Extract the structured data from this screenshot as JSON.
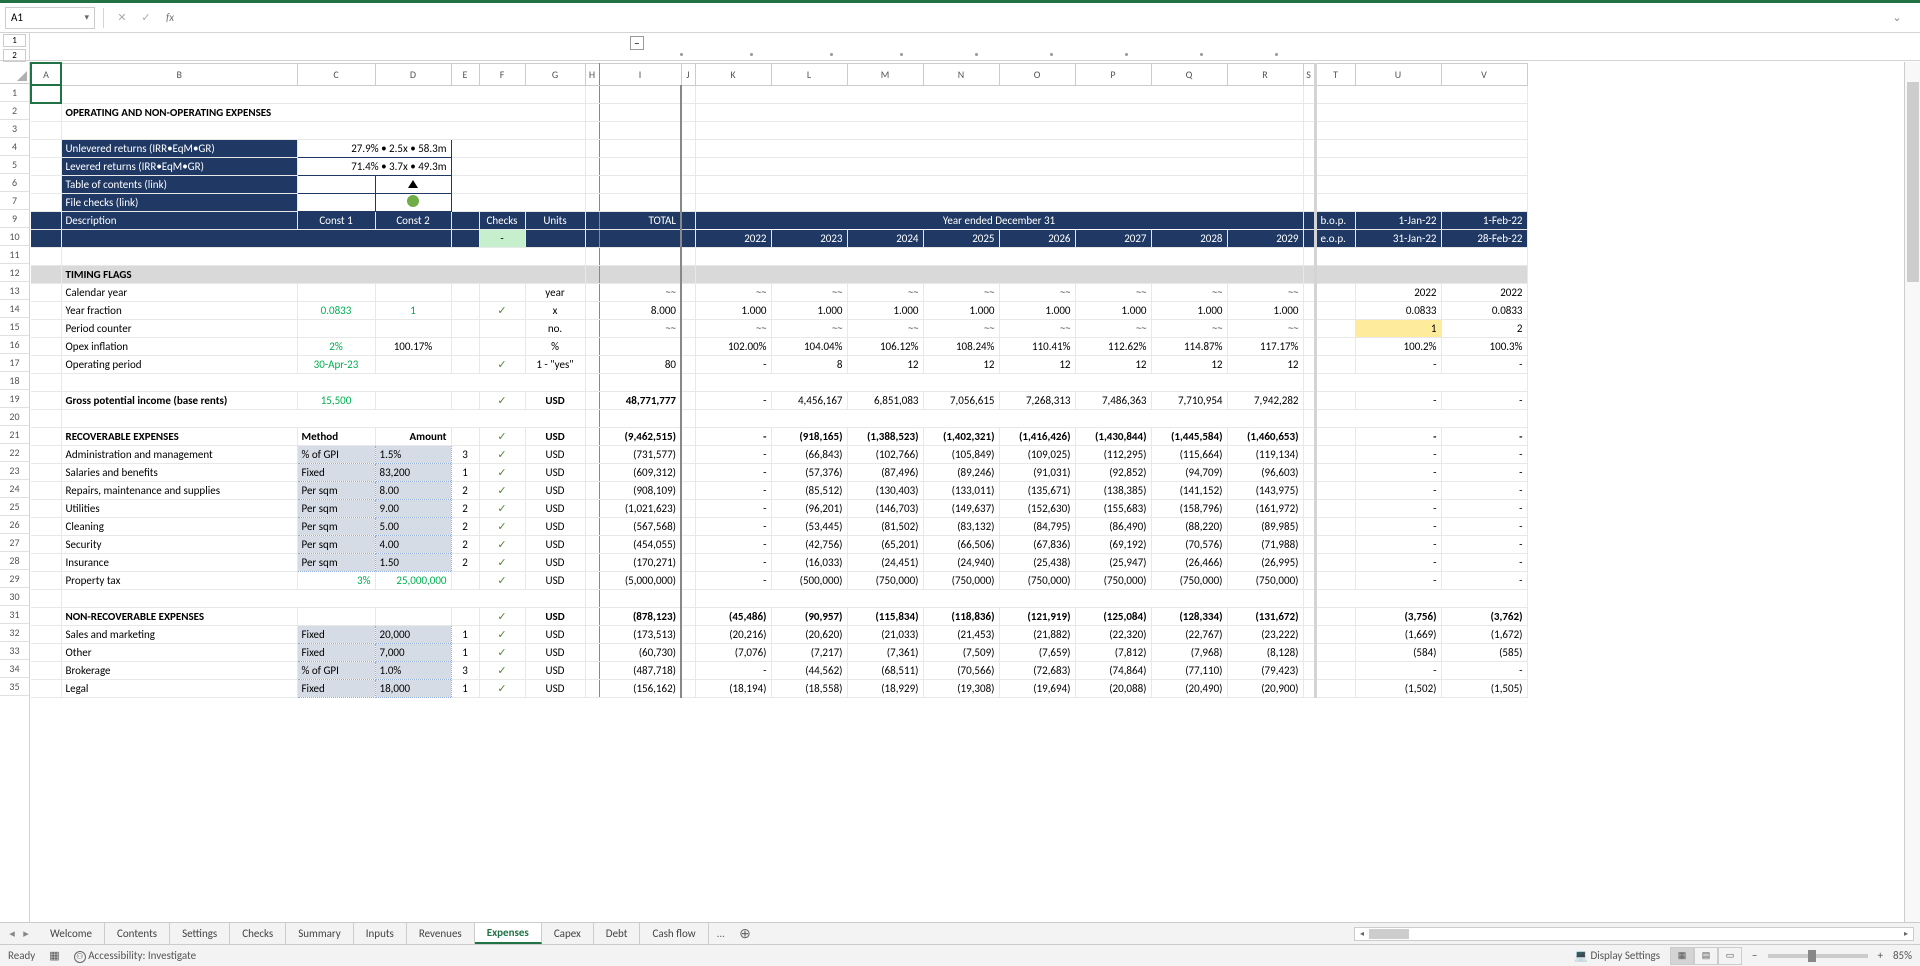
{
  "cell_ref": "A1",
  "fx_label": "fx",
  "outline": {
    "level1": "1",
    "level2": "2",
    "minus": "−"
  },
  "title": "OPERATING AND NON-OPERATING EXPENSES",
  "summary": {
    "unlev_label": "Unlevered returns (IRR•EqM•GR)",
    "unlev_val": "27.9% • 2.5x • 58.3m",
    "lev_label": "Levered returns (IRR•EqM•GR)",
    "lev_val": "71.4% • 3.7x • 49.3m",
    "toc": "Table of contents (link)",
    "checks": "File checks (link)"
  },
  "hdr": {
    "desc": "Description",
    "c1": "Const 1",
    "c2": "Const 2",
    "checks": "Checks",
    "units": "Units",
    "total": "TOTAL",
    "year_ended": "Year ended December 31",
    "bop": "b.o.p.",
    "eop": "e.o.p.",
    "d1": "1-Jan-22",
    "d2": "1-Feb-22",
    "d3": "31-Jan-22",
    "d4": "28-Feb-22",
    "dash": "-"
  },
  "years": [
    "2022",
    "2023",
    "2024",
    "2025",
    "2026",
    "2027",
    "2028",
    "2029"
  ],
  "cols": [
    "A",
    "B",
    "C",
    "D",
    "E",
    "F",
    "G",
    "H",
    "I",
    "J",
    "K",
    "L",
    "M",
    "N",
    "O",
    "P",
    "Q",
    "R",
    "S",
    "T",
    "U",
    "V"
  ],
  "rows": [
    "1",
    "2",
    "3",
    "4",
    "5",
    "6",
    "7",
    "9",
    "10",
    "11",
    "12",
    "13",
    "14",
    "15",
    "16",
    "17",
    "18",
    "19",
    "20",
    "21",
    "22",
    "23",
    "24",
    "25",
    "26",
    "27",
    "28",
    "29",
    "30",
    "31",
    "32",
    "33",
    "34",
    "35"
  ],
  "sec": {
    "timing": "TIMING FLAGS",
    "recov": "RECOVERABLE EXPENSES",
    "method": "Method",
    "amount": "Amount",
    "nonrecov": "NON-RECOVERABLE EXPENSES"
  },
  "r": {
    "cal": {
      "lbl": "Calendar year",
      "unit": "year",
      "u": "2022",
      "v": "2022"
    },
    "yf": {
      "lbl": "Year fraction",
      "c1": "0.0833",
      "c2": "1",
      "unit": "x",
      "tot": "8.000",
      "vals": [
        "1.000",
        "1.000",
        "1.000",
        "1.000",
        "1.000",
        "1.000",
        "1.000",
        "1.000"
      ],
      "u": "0.0833",
      "v": "0.0833"
    },
    "pc": {
      "lbl": "Period counter",
      "unit": "no.",
      "u": "1",
      "v": "2"
    },
    "oi": {
      "lbl": "Opex inflation",
      "c1": "2%",
      "c2": "100.17%",
      "unit": "%",
      "vals": [
        "102.00%",
        "104.04%",
        "106.12%",
        "108.24%",
        "110.41%",
        "112.62%",
        "114.87%",
        "117.17%"
      ],
      "u": "100.2%",
      "v": "100.3%"
    },
    "op": {
      "lbl": "Operating period",
      "c1": "30-Apr-23",
      "unit": "1 - \"yes\"",
      "tot": "80",
      "vals": [
        "-",
        "8",
        "12",
        "12",
        "12",
        "12",
        "12",
        "12"
      ],
      "u": "-",
      "v": "-"
    },
    "gpi": {
      "lbl": "Gross potential income (base rents)",
      "c1": "15,500",
      "unit": "USD",
      "tot": "48,771,777",
      "vals": [
        "-",
        "4,456,167",
        "6,851,083",
        "7,056,615",
        "7,268,313",
        "7,486,363",
        "7,710,954",
        "7,942,282"
      ],
      "u": "-",
      "v": "-"
    },
    "re": {
      "unit": "USD",
      "tot": "(9,462,515)",
      "vals": [
        "-",
        "(918,165)",
        "(1,388,523)",
        "(1,402,321)",
        "(1,416,426)",
        "(1,430,844)",
        "(1,445,584)",
        "(1,460,653)"
      ],
      "u": "-",
      "v": "-"
    },
    "admin": {
      "lbl": "Administration and management",
      "m": "% of GPI",
      "a": "1.5%",
      "n": "3",
      "unit": "USD",
      "tot": "(731,577)",
      "vals": [
        "-",
        "(66,843)",
        "(102,766)",
        "(105,849)",
        "(109,025)",
        "(112,295)",
        "(115,664)",
        "(119,134)"
      ],
      "u": "-",
      "v": "-"
    },
    "sal": {
      "lbl": "Salaries and benefits",
      "m": "Fixed",
      "a": "83,200",
      "n": "1",
      "unit": "USD",
      "tot": "(609,312)",
      "vals": [
        "-",
        "(57,376)",
        "(87,496)",
        "(89,246)",
        "(91,031)",
        "(92,852)",
        "(94,709)",
        "(96,603)"
      ],
      "u": "-",
      "v": "-"
    },
    "rep": {
      "lbl": "Repairs, maintenance and supplies",
      "m": "Per sqm",
      "a": "8.00",
      "n": "2",
      "unit": "USD",
      "tot": "(908,109)",
      "vals": [
        "-",
        "(85,512)",
        "(130,403)",
        "(133,011)",
        "(135,671)",
        "(138,385)",
        "(141,152)",
        "(143,975)"
      ],
      "u": "-",
      "v": "-"
    },
    "util": {
      "lbl": "Utilities",
      "m": "Per sqm",
      "a": "9.00",
      "n": "2",
      "unit": "USD",
      "tot": "(1,021,623)",
      "vals": [
        "-",
        "(96,201)",
        "(146,703)",
        "(149,637)",
        "(152,630)",
        "(155,683)",
        "(158,796)",
        "(161,972)"
      ],
      "u": "-",
      "v": "-"
    },
    "clean": {
      "lbl": "Cleaning",
      "m": "Per sqm",
      "a": "5.00",
      "n": "2",
      "unit": "USD",
      "tot": "(567,568)",
      "vals": [
        "-",
        "(53,445)",
        "(81,502)",
        "(83,132)",
        "(84,795)",
        "(86,490)",
        "(88,220)",
        "(89,985)"
      ],
      "u": "-",
      "v": "-"
    },
    "sec2": {
      "lbl": "Security",
      "m": "Per sqm",
      "a": "4.00",
      "n": "2",
      "unit": "USD",
      "tot": "(454,055)",
      "vals": [
        "-",
        "(42,756)",
        "(65,201)",
        "(66,506)",
        "(67,836)",
        "(69,192)",
        "(70,576)",
        "(71,988)"
      ],
      "u": "-",
      "v": "-"
    },
    "ins": {
      "lbl": "Insurance",
      "m": "Per sqm",
      "a": "1.50",
      "n": "2",
      "unit": "USD",
      "tot": "(170,271)",
      "vals": [
        "-",
        "(16,033)",
        "(24,451)",
        "(24,940)",
        "(25,438)",
        "(25,947)",
        "(26,466)",
        "(26,995)"
      ],
      "u": "-",
      "v": "-"
    },
    "tax": {
      "lbl": "Property tax",
      "c1": "3%",
      "c2": "25,000,000",
      "unit": "USD",
      "tot": "(5,000,000)",
      "vals": [
        "-",
        "(500,000)",
        "(750,000)",
        "(750,000)",
        "(750,000)",
        "(750,000)",
        "(750,000)",
        "(750,000)"
      ],
      "u": "-",
      "v": "-"
    },
    "nr": {
      "unit": "USD",
      "tot": "(878,123)",
      "vals": [
        "(45,486)",
        "(90,957)",
        "(115,834)",
        "(118,836)",
        "(121,919)",
        "(125,084)",
        "(128,334)",
        "(131,672)"
      ],
      "u": "(3,756)",
      "v": "(3,762)"
    },
    "sm": {
      "lbl": "Sales and marketing",
      "m": "Fixed",
      "a": "20,000",
      "n": "1",
      "unit": "USD",
      "tot": "(173,513)",
      "vals": [
        "(20,216)",
        "(20,620)",
        "(21,033)",
        "(21,453)",
        "(21,882)",
        "(22,320)",
        "(22,767)",
        "(23,222)"
      ],
      "u": "(1,669)",
      "v": "(1,672)"
    },
    "oth": {
      "lbl": "Other",
      "m": "Fixed",
      "a": "7,000",
      "n": "1",
      "unit": "USD",
      "tot": "(60,730)",
      "vals": [
        "(7,076)",
        "(7,217)",
        "(7,361)",
        "(7,509)",
        "(7,659)",
        "(7,812)",
        "(7,968)",
        "(8,128)"
      ],
      "u": "(584)",
      "v": "(585)"
    },
    "brk": {
      "lbl": "Brokerage",
      "m": "% of GPI",
      "a": "1.0%",
      "n": "3",
      "unit": "USD",
      "tot": "(487,718)",
      "vals": [
        "-",
        "(44,562)",
        "(68,511)",
        "(70,566)",
        "(72,683)",
        "(74,864)",
        "(77,110)",
        "(79,423)"
      ],
      "u": "-",
      "v": "-"
    },
    "leg": {
      "lbl": "Legal",
      "m": "Fixed",
      "a": "18,000",
      "n": "1",
      "unit": "USD",
      "tot": "(156,162)",
      "vals": [
        "(18,194)",
        "(18,558)",
        "(18,929)",
        "(19,308)",
        "(19,694)",
        "(20,088)",
        "(20,490)",
        "(20,900)"
      ],
      "u": "(1,502)",
      "v": "(1,505)"
    }
  },
  "tildes": "~~",
  "check": "✓",
  "tabs": [
    "Welcome",
    "Contents",
    "Settings",
    "Checks",
    "Summary",
    "Inputs",
    "Revenues",
    "Expenses",
    "Capex",
    "Debt",
    "Cash flow"
  ],
  "active_tab": "Expenses",
  "tab_more": "...",
  "status": {
    "ready": "Ready",
    "acc": "Accessibility: Investigate",
    "disp": "Display Settings",
    "zoom": "85%"
  }
}
